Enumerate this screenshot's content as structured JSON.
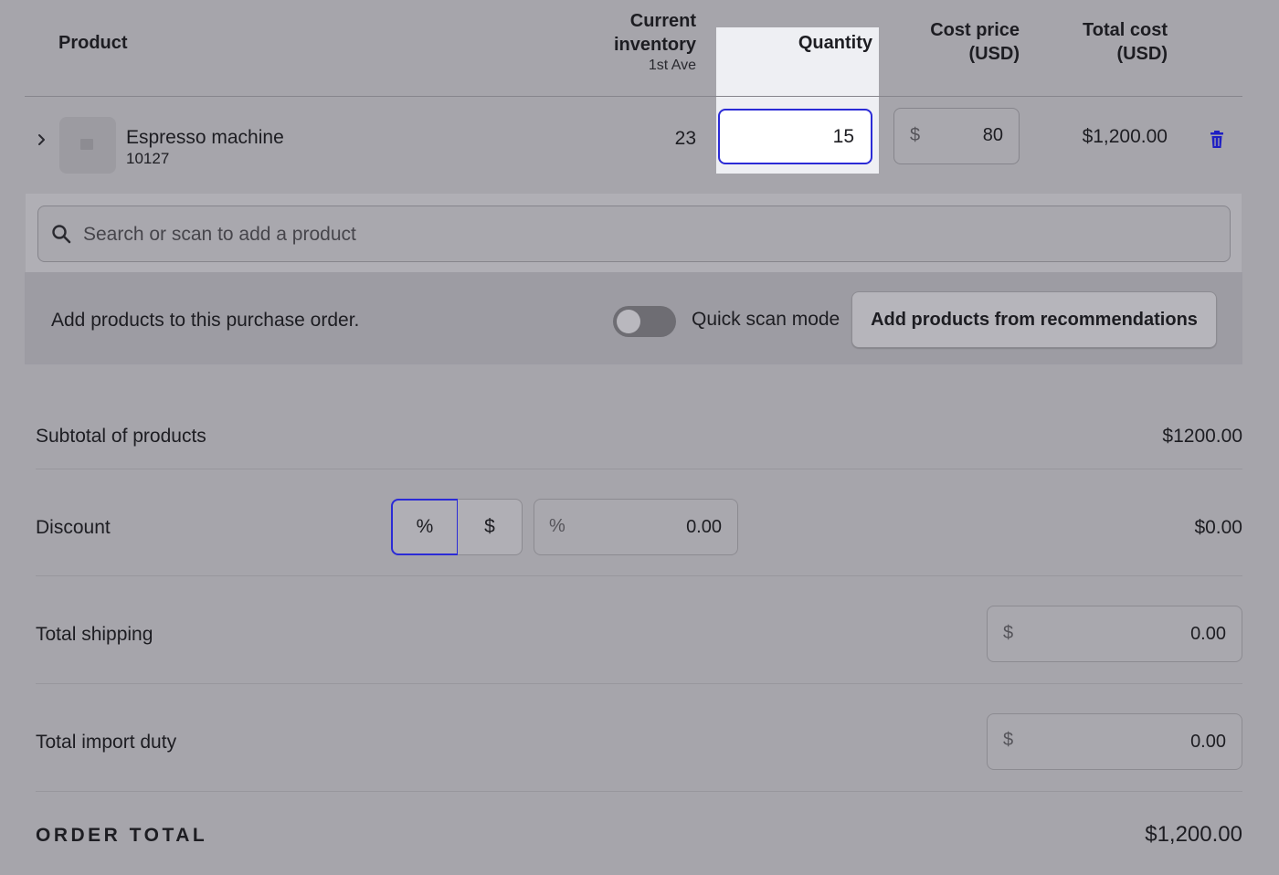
{
  "table": {
    "headers": {
      "product": "Product",
      "inventory_line1": "Current",
      "inventory_line2": "inventory",
      "inventory_location": "1st Ave",
      "quantity": "Quantity",
      "cost_line1": "Cost price",
      "cost_line2": "(USD)",
      "total_line1": "Total cost",
      "total_line2": "(USD)"
    },
    "rows": [
      {
        "name": "Espresso machine",
        "sku": "10127",
        "inventory": "23",
        "quantity": "15",
        "cost_currency": "$",
        "cost_price": "80",
        "total_cost": "$1,200.00"
      }
    ]
  },
  "search": {
    "placeholder": "Search or scan to add a product"
  },
  "add_products": {
    "text": "Add products to this purchase order.",
    "quick_scan_label": "Quick scan mode",
    "quick_scan_enabled": false,
    "recommendations_button": "Add products from recommendations"
  },
  "summary": {
    "subtotal_label": "Subtotal of products",
    "subtotal_value": "$1200.00",
    "discount_label": "Discount",
    "discount_type_pct": "%",
    "discount_type_usd": "$",
    "discount_selected": "%",
    "discount_unit": "%",
    "discount_input": "0.00",
    "discount_value": "$0.00",
    "shipping_label": "Total shipping",
    "shipping_currency": "$",
    "shipping_input": "0.00",
    "import_duty_label": "Total import duty",
    "import_duty_currency": "$",
    "import_duty_input": "0.00",
    "order_total_label": "ORDER TOTAL",
    "order_total_value": "$1,200.00"
  },
  "colors": {
    "overlay_background": "#a6a5ab",
    "focus_ring": "#2b2bd6",
    "highlight_column": "#eeeff3",
    "delete_icon": "#1f1fc4"
  },
  "icons": [
    "chevron-right-icon",
    "product-image-placeholder-icon",
    "trash-icon",
    "search-icon"
  ]
}
